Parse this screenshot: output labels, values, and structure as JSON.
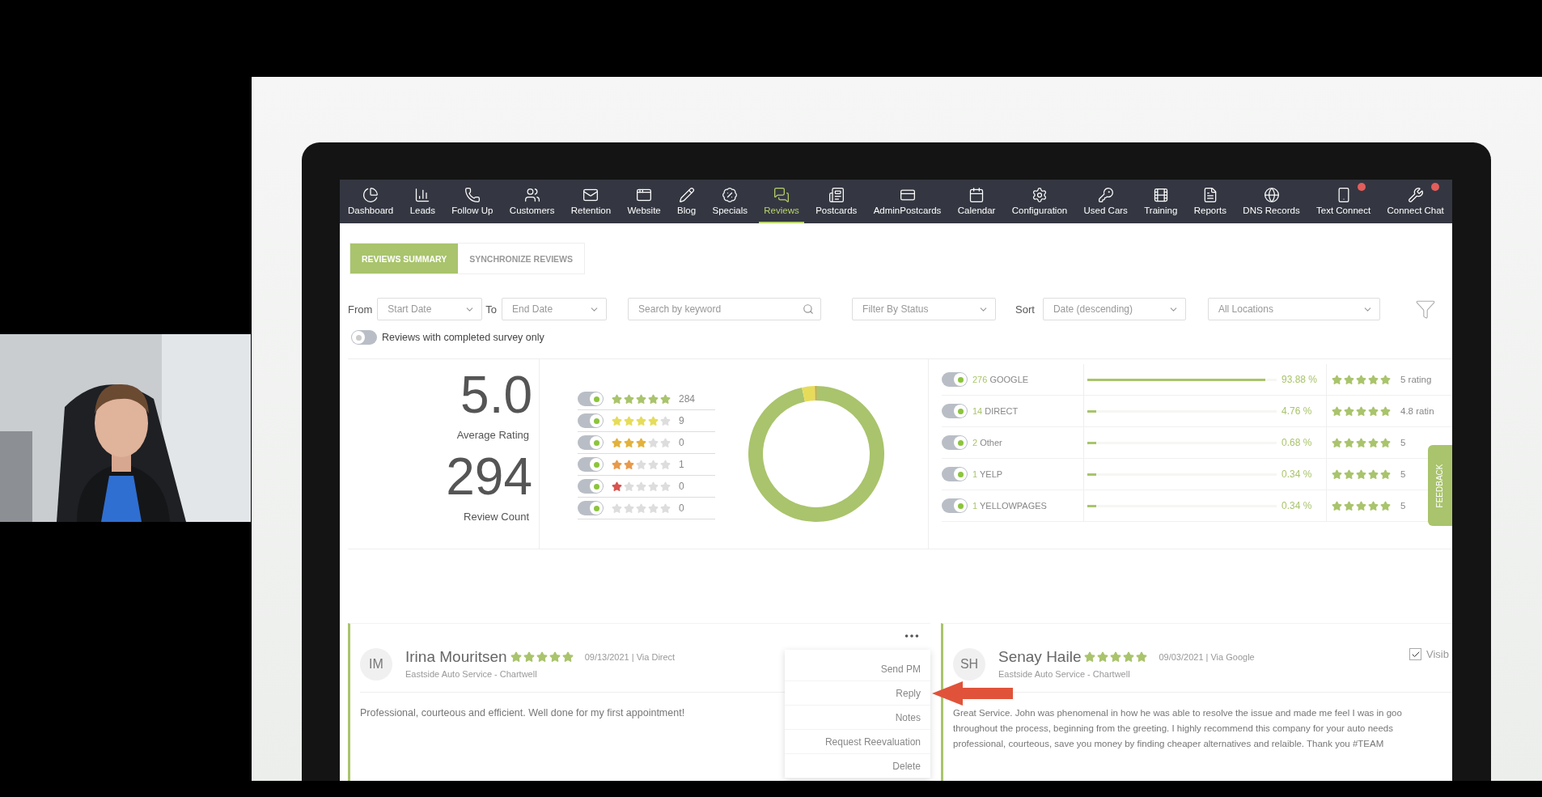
{
  "nav": [
    {
      "label": "Dashboard",
      "selected": false,
      "badge": false
    },
    {
      "label": "Leads",
      "selected": false,
      "badge": false
    },
    {
      "label": "Follow Up",
      "selected": false,
      "badge": false
    },
    {
      "label": "Customers",
      "selected": false,
      "badge": false
    },
    {
      "label": "Retention",
      "selected": false,
      "badge": false
    },
    {
      "label": "Website",
      "selected": false,
      "badge": false
    },
    {
      "label": "Blog",
      "selected": false,
      "badge": false
    },
    {
      "label": "Specials",
      "selected": false,
      "badge": false
    },
    {
      "label": "Reviews",
      "selected": true,
      "badge": false
    },
    {
      "label": "Postcards",
      "selected": false,
      "badge": false
    },
    {
      "label": "AdminPostcards",
      "selected": false,
      "badge": false
    },
    {
      "label": "Calendar",
      "selected": false,
      "badge": false
    },
    {
      "label": "Configuration",
      "selected": false,
      "badge": false
    },
    {
      "label": "Used Cars",
      "selected": false,
      "badge": false
    },
    {
      "label": "Training",
      "selected": false,
      "badge": false
    },
    {
      "label": "Reports",
      "selected": false,
      "badge": false
    },
    {
      "label": "DNS Records",
      "selected": false,
      "badge": false
    },
    {
      "label": "Text Connect",
      "selected": false,
      "badge": true
    },
    {
      "label": "Connect Chat",
      "selected": false,
      "badge": true
    }
  ],
  "tabs": [
    {
      "label": "REVIEWS SUMMARY",
      "selected": true
    },
    {
      "label": "SYNCHRONIZE REVIEWS",
      "selected": false
    }
  ],
  "filters": {
    "from_label": "From",
    "start_placeholder": "Start Date",
    "to_label": "To",
    "end_placeholder": "End Date",
    "search_placeholder": "Search by keyword",
    "status_placeholder": "Filter By Status",
    "sort_label": "Sort",
    "sort_value": "Date (descending)",
    "location_value": "All Locations"
  },
  "survey_toggle": {
    "label": "Reviews with completed survey only",
    "on": false
  },
  "summary": {
    "average": "5.0",
    "average_label": "Average Rating",
    "count": "294",
    "count_label": "Review Count"
  },
  "rating_rows": [
    {
      "stars": 5,
      "count": "284",
      "on": true
    },
    {
      "stars": 4,
      "count": "9",
      "on": true
    },
    {
      "stars": 3,
      "count": "0",
      "on": true
    },
    {
      "stars": 2,
      "count": "1",
      "on": true
    },
    {
      "stars": 1,
      "count": "0",
      "on": true
    },
    {
      "stars": 0,
      "count": "0",
      "on": true
    }
  ],
  "sources": [
    {
      "count": "276",
      "name": "GOOGLE",
      "on": true,
      "level": 0.9388,
      "percent": "93.88 %",
      "stars": 5,
      "rating": "5 rating"
    },
    {
      "count": "14",
      "name": "DIRECT",
      "on": true,
      "level": 0.0476,
      "percent": "4.76 %",
      "stars": 5,
      "rating": "4.8 ratin"
    },
    {
      "count": "2",
      "name": "Other",
      "on": true,
      "level": 0.0068,
      "percent": "0.68 %",
      "stars": 5,
      "rating": "5"
    },
    {
      "count": "1",
      "name": "YELP",
      "on": true,
      "level": 0.0034,
      "percent": "0.34 %",
      "stars": 5,
      "rating": "5"
    },
    {
      "count": "1",
      "name": "YELLOWPAGES",
      "on": true,
      "level": 0.0034,
      "percent": "0.34 %",
      "stars": 5,
      "rating": "5"
    }
  ],
  "feedback_tab": "FEEDBACK",
  "reviews": [
    {
      "initials": "IM",
      "name": "Irina Mouritsen",
      "stars": 5,
      "meta": "09/13/2021 | Via Direct",
      "location": "Eastside Auto Service - Chartwell",
      "text": "Professional, courteous and efficient. Well done for my first appointment!",
      "menu": {
        "open": true,
        "items": [
          "Send PM",
          "Reply",
          "Notes",
          "Request Reevaluation",
          "Delete"
        ]
      }
    },
    {
      "initials": "SH",
      "name": "Senay Haile",
      "stars": 5,
      "meta": "09/03/2021 | Via Google",
      "location": "Eastside Auto Service - Chartwell",
      "text_lines": [
        "Great Service. John was phenomenal in how he was able to resolve the issue and made me feel I was in goo",
        "throughout the process, beginning from the greeting. I highly recommend this company for your auto needs",
        "professional, courteous, save you money by finding cheaper alternatives and relaible. Thank you #TEAM"
      ],
      "visible_checkbox": {
        "label": "Visib",
        "checked": true
      }
    }
  ]
}
